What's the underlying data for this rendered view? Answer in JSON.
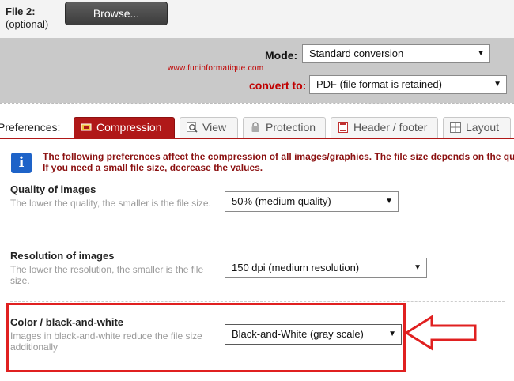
{
  "file2": {
    "label_main": "File 2:",
    "label_sub": "(optional)",
    "browse_label": "Browse..."
  },
  "options": {
    "mode_label": "Mode:",
    "mode_value": "Standard conversion",
    "watermark": "www.funinformatique.com",
    "convert_label": "convert to:",
    "convert_value": "PDF (file format is retained)"
  },
  "preferences": {
    "label": "Preferences:",
    "tabs": [
      {
        "label": "Compression",
        "icon": "compression-icon",
        "active": true
      },
      {
        "label": "View",
        "icon": "magnifier-icon",
        "active": false
      },
      {
        "label": "Protection",
        "icon": "lock-icon",
        "active": false
      },
      {
        "label": "Header / footer",
        "icon": "document-icon",
        "active": false
      },
      {
        "label": "Layout",
        "icon": "grid-icon",
        "active": false
      }
    ]
  },
  "info": {
    "line1": "The following preferences affect the compression of all images/graphics. The file size depends on the qu",
    "line2": "If you need a small file size, decrease the values."
  },
  "settings": {
    "quality": {
      "title": "Quality of images",
      "desc": "The lower the quality, the smaller is the file size.",
      "value": "50% (medium quality)"
    },
    "resolution": {
      "title": "Resolution of images",
      "desc": "The lower the resolution, the smaller is the file size.",
      "value": "150 dpi (medium resolution)"
    },
    "color": {
      "title": "Color / black-and-white",
      "desc": "Images in black-and-white reduce the file size additionally",
      "value": "Black-and-White (gray scale)"
    }
  },
  "colors": {
    "accent": "#b01818",
    "highlight": "#e02020",
    "info_text": "#8b1010",
    "info_icon": "#1e63c8"
  }
}
